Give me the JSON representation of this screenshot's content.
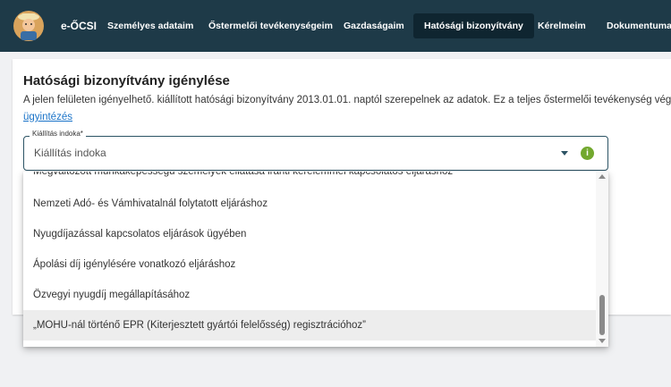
{
  "header": {
    "logo_icon": "farmer-mascot-icon",
    "brand": "e-ŐCSI",
    "nav": [
      {
        "label": "Személyes adataim"
      },
      {
        "label": "Őstermelői tevékenységeim"
      },
      {
        "label": "Gazdaságaim"
      },
      {
        "label": "Hatósági bizonyítvány",
        "active": true
      },
      {
        "label": "Kérelmeim"
      },
      {
        "label": "Dokumentumaim"
      }
    ]
  },
  "page": {
    "title": "Hatósági bizonyítvány igénylése",
    "description": "A jelen felületen igényelhető. kiállított hatósági bizonyítvány 2013.01.01. naptól szerepelnek az adatok. Ez a teljes őstermelői tevékenység végzé",
    "link": "ügyintézés"
  },
  "select": {
    "label": "Kiállítás indoka*",
    "placeholder": "Kiállítás indoka",
    "info_icon": "info-icon",
    "options": [
      "Megváltozott munkaképességű személyek ellátása iránti kérelemmel kapcsolatos eljáráshoz",
      "Nemzeti Adó- és Vámhivatalnál folytatott eljáráshoz",
      "Nyugdíjazással kapcsolatos eljárások ügyében",
      "Ápolási díj igénylésére vonatkozó eljáráshoz",
      "Özvegyi nyugdíj megállapításához",
      "„MOHU-nál történő EPR (Kiterjesztett gyártói felelősség) regisztrációhoz”"
    ]
  },
  "colors": {
    "nav_bg": "#1e3a48",
    "nav_active_bg": "#0f2530",
    "accent": "#2c5364",
    "info_green": "#72a82e",
    "link": "#1a73c8"
  }
}
